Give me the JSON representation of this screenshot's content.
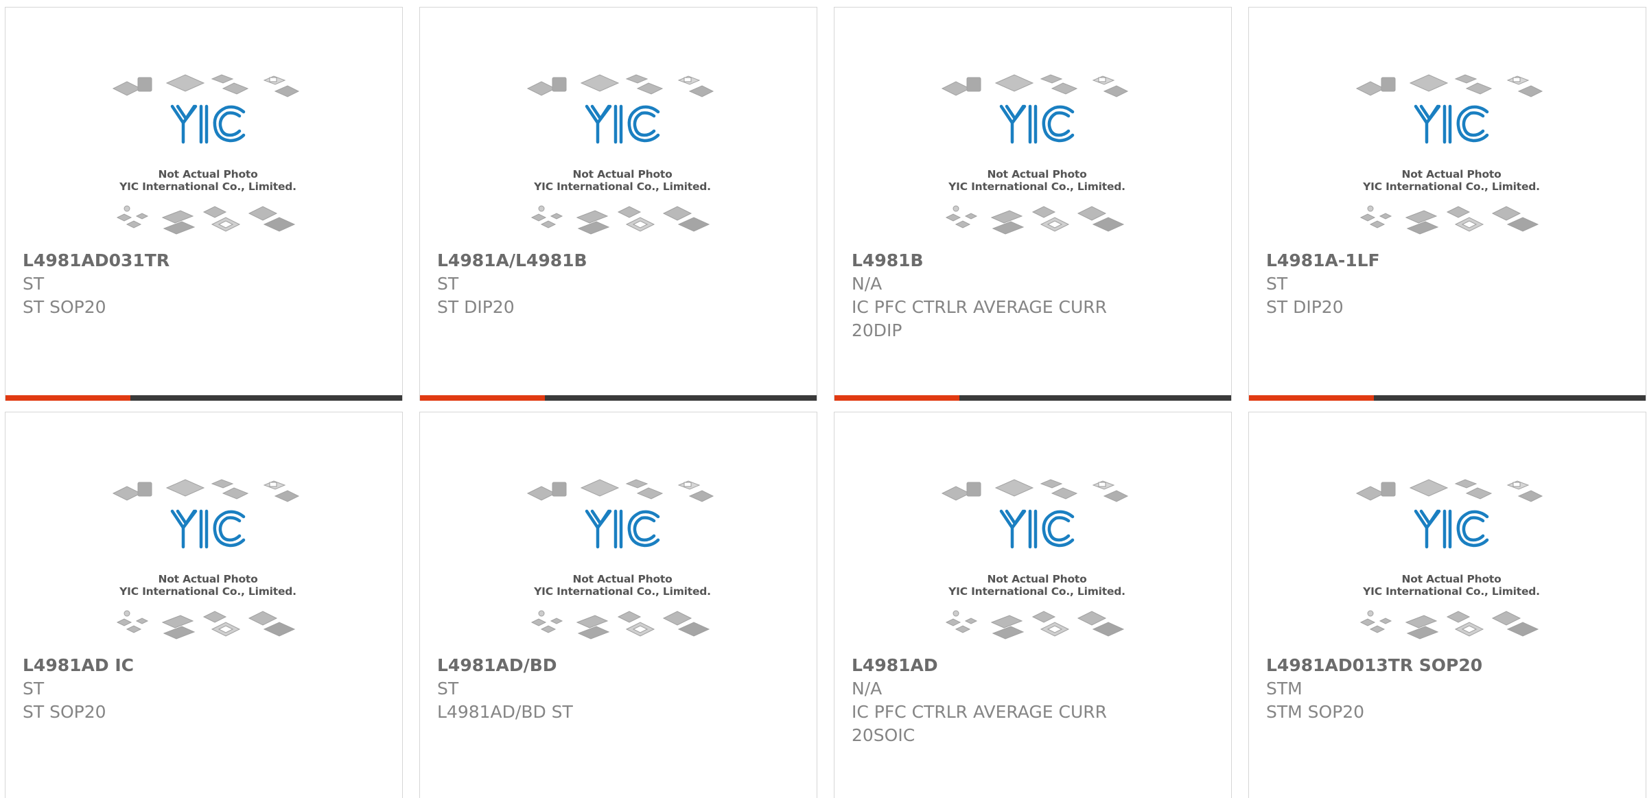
{
  "placeholder": {
    "logo_text": "YIC",
    "line1": "Not Actual Photo",
    "line2": "YIC International Co., Limited."
  },
  "colors": {
    "accent": "#e13a12",
    "bar": "#3a3a3a",
    "logo": "#1a7fc1",
    "text_title": "#6b6b6b",
    "text_body": "#858585"
  },
  "products": [
    {
      "name": "L4981AD031TR",
      "brand": "ST",
      "desc": "ST SOP20"
    },
    {
      "name": "L4981A/L4981B",
      "brand": "ST",
      "desc": "ST DIP20"
    },
    {
      "name": "L4981B",
      "brand": "N/A",
      "desc": "IC PFC CTRLR AVERAGE CURR 20DIP"
    },
    {
      "name": "L4981A-1LF",
      "brand": "ST",
      "desc": "ST DIP20"
    },
    {
      "name": "L4981AD IC",
      "brand": "ST",
      "desc": "ST SOP20"
    },
    {
      "name": "L4981AD/BD",
      "brand": "ST",
      "desc": "L4981AD/BD ST"
    },
    {
      "name": "L4981AD",
      "brand": "N/A",
      "desc": "IC PFC CTRLR AVERAGE CURR 20SOIC"
    },
    {
      "name": "L4981AD013TR SOP20",
      "brand": "STM",
      "desc": "STM SOP20"
    }
  ]
}
